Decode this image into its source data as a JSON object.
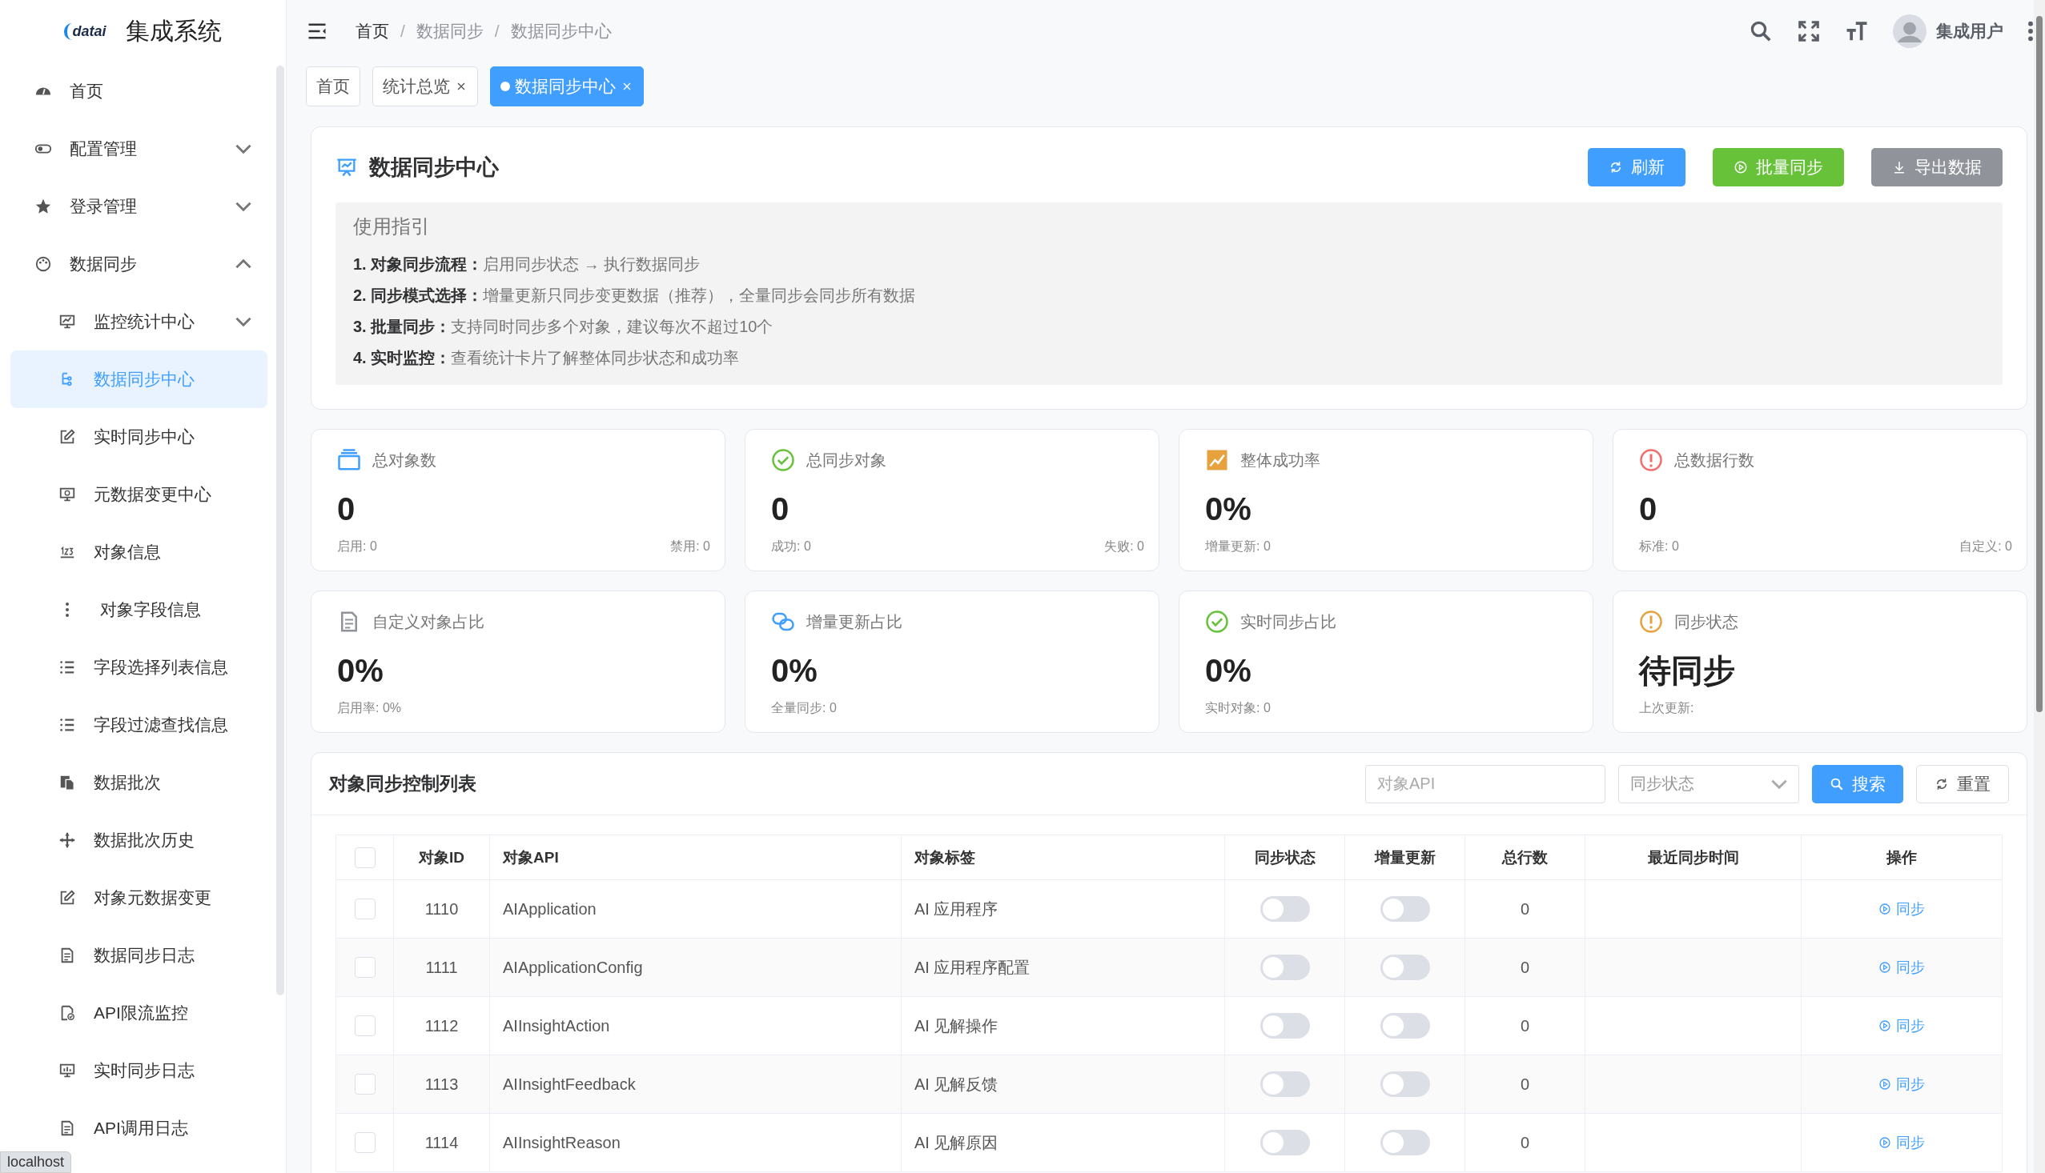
{
  "sidebar": {
    "logo_text": "datai",
    "title": "集成系统",
    "items": [
      {
        "label": "首页",
        "selected": false
      },
      {
        "label": "配置管理",
        "selected": false,
        "expanded": false
      },
      {
        "label": "登录管理",
        "selected": false,
        "expanded": false
      },
      {
        "label": "数据同步",
        "selected": false,
        "expanded": true,
        "children": [
          {
            "label": "监控统计中心",
            "selected": false,
            "expanded": false
          },
          {
            "label": "数据同步中心",
            "selected": true
          },
          {
            "label": "实时同步中心",
            "selected": false
          },
          {
            "label": "元数据变更中心",
            "selected": false
          },
          {
            "label": "对象信息",
            "selected": false
          },
          {
            "label": "对象字段信息",
            "selected": false
          },
          {
            "label": "字段选择列表信息",
            "selected": false
          },
          {
            "label": "字段过滤查找信息",
            "selected": false
          },
          {
            "label": "数据批次",
            "selected": false
          },
          {
            "label": "数据批次历史",
            "selected": false
          },
          {
            "label": "对象元数据变更",
            "selected": false
          },
          {
            "label": "数据同步日志",
            "selected": false
          },
          {
            "label": "API限流监控",
            "selected": false
          },
          {
            "label": "实时同步日志",
            "selected": false
          },
          {
            "label": "API调用日志",
            "selected": false
          }
        ]
      }
    ]
  },
  "header": {
    "breadcrumb": [
      "首页",
      "数据同步",
      "数据同步中心"
    ],
    "breadcrumb_separator": "/",
    "user": "集成用户"
  },
  "tabs": [
    {
      "label": "首页",
      "closable": false,
      "selected": false
    },
    {
      "label": "统计总览",
      "closable": true,
      "selected": false
    },
    {
      "label": "数据同步中心",
      "closable": true,
      "selected": true
    }
  ],
  "page": {
    "title": "数据同步中心",
    "buttons": [
      {
        "label": "刷新",
        "kind": "primary"
      },
      {
        "label": "批量同步",
        "kind": "success"
      },
      {
        "label": "导出数据",
        "kind": "info"
      }
    ],
    "guide": {
      "title": "使用指引",
      "items": [
        "**1. 对象同步流程：**启用同步状态 → 执行数据同步",
        "**2. 同步模式选择：**增量更新只同步变更数据（推荐），全量同步会同步所有数据",
        "**3. 批量同步：**支持同时同步多个对象，建议每次不超过10个",
        "**4. 实时监控：**查看统计卡片了解整体同步状态和成功率"
      ]
    }
  },
  "stats": [
    {
      "title": "总对象数",
      "value": "0",
      "left": "启用: 0",
      "right": "禁用: 0",
      "color": "#409eff"
    },
    {
      "title": "总同步对象",
      "value": "0",
      "left": "成功: 0",
      "right": "失败: 0",
      "color": "#67c23a"
    },
    {
      "title": "整体成功率",
      "value": "0%",
      "left": "增量更新: 0",
      "color": "#e6a23c"
    },
    {
      "title": "总数据行数",
      "value": "0",
      "left": "标准: 0",
      "right": "自定义: 0",
      "color": "#f56c6c"
    },
    {
      "title": "自定义对象占比",
      "value": "0%",
      "left": "启用率: 0%",
      "color": "#909399"
    },
    {
      "title": "增量更新占比",
      "value": "0%",
      "left": "全量同步: 0",
      "color": "#409eff"
    },
    {
      "title": "实时同步占比",
      "value": "0%",
      "left": "实时对象: 0",
      "color": "#67c23a"
    },
    {
      "title": "同步状态",
      "value": "待同步",
      "left": "上次更新:",
      "color": "#e6a23c"
    }
  ],
  "table": {
    "title": "对象同步控制列表",
    "search": {
      "placeholder": "对象API"
    },
    "filter": {
      "placeholder": "同步状态"
    },
    "search_button": "搜索",
    "reset_button": "重置",
    "select_all": {
      "checked": false
    },
    "columns": [
      "对象ID",
      "对象API",
      "对象标签",
      "同步状态",
      "增量更新",
      "总行数",
      "最近同步时间",
      "操作"
    ],
    "rows": [
      {
        "checked": false,
        "id": "1110",
        "api": "AIApplication",
        "label": "AI 应用程序",
        "sync_on": false,
        "incremental_on": false,
        "total": "0",
        "action": "同步"
      },
      {
        "checked": false,
        "id": "1111",
        "api": "AIApplicationConfig",
        "label": "AI 应用程序配置",
        "sync_on": false,
        "incremental_on": false,
        "total": "0",
        "action": "同步"
      },
      {
        "checked": false,
        "id": "1112",
        "api": "AIInsightAction",
        "label": "AI 见解操作",
        "sync_on": false,
        "incremental_on": false,
        "total": "0",
        "action": "同步"
      },
      {
        "checked": false,
        "id": "1113",
        "api": "AIInsightFeedback",
        "label": "AI 见解反馈",
        "sync_on": false,
        "incremental_on": false,
        "total": "0",
        "action": "同步"
      },
      {
        "checked": false,
        "id": "1114",
        "api": "AIInsightReason",
        "label": "AI 见解原因",
        "sync_on": false,
        "incremental_on": false,
        "total": "0",
        "action": "同步"
      }
    ]
  },
  "status_bar": "localhost"
}
